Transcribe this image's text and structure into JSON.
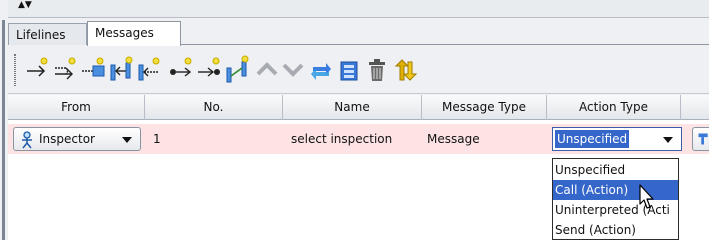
{
  "collapse": {
    "arrows": "▲▼"
  },
  "tabs": [
    {
      "label": "Lifelines",
      "active": false
    },
    {
      "label": "Messages",
      "active": true
    }
  ],
  "toolbar": {
    "icons": [
      "new-message-icon",
      "new-self-message-icon",
      "new-create-message-icon",
      "new-return-message-icon",
      "new-reply-message-icon",
      "new-found-message-icon",
      "new-lost-message-icon",
      "new-duplicate-message-icon",
      "move-up-icon",
      "move-down-icon",
      "refresh-icon",
      "table-icon",
      "delete-icon",
      "sort-icon"
    ]
  },
  "table": {
    "columns": [
      "From",
      "No.",
      "Name",
      "Message Type",
      "Action Type"
    ],
    "row": {
      "from": "Inspector",
      "no": "1",
      "name": "select inspection",
      "message_type": "Message",
      "action_type": "Unspecified"
    }
  },
  "dropdown": {
    "options": [
      {
        "label": "Unspecified",
        "selected": false
      },
      {
        "label": "Call (Action)",
        "selected": true
      },
      {
        "label": "Uninterpreted (Acti",
        "selected": false
      },
      {
        "label": "Send (Action)",
        "selected": false
      }
    ]
  },
  "colors": {
    "row_highlight": "#fde3e4",
    "selection_blue": "#3566c9"
  }
}
